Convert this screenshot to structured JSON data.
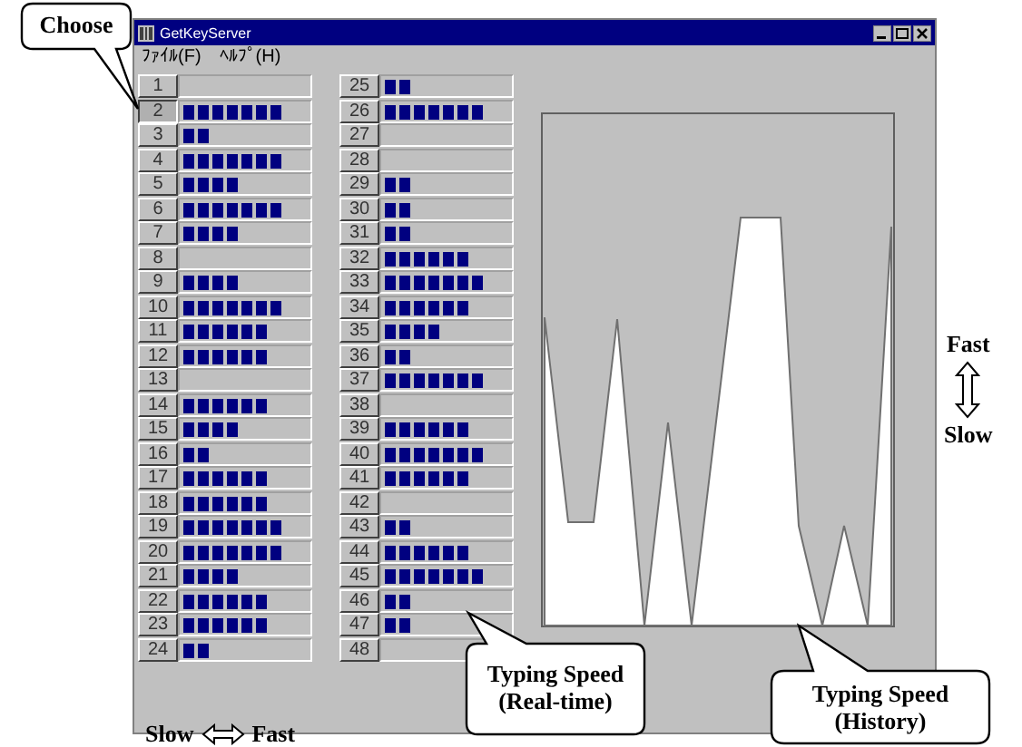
{
  "window": {
    "title": "GetKeyServer"
  },
  "menu": [
    "ﾌｧｲﾙ(F)",
    "ﾍﾙﾌﾟ(H)"
  ],
  "keys": [
    {
      "label": "1",
      "level": 0,
      "selected": false
    },
    {
      "label": "2",
      "level": 0.78,
      "selected": true
    },
    {
      "label": "3",
      "level": 0.22,
      "selected": false
    },
    {
      "label": "4",
      "level": 0.78,
      "selected": false
    },
    {
      "label": "5",
      "level": 0.44,
      "selected": false
    },
    {
      "label": "6",
      "level": 0.78,
      "selected": false
    },
    {
      "label": "7",
      "level": 0.44,
      "selected": false
    },
    {
      "label": "8",
      "level": 0,
      "selected": false
    },
    {
      "label": "9",
      "level": 0.44,
      "selected": false
    },
    {
      "label": "10",
      "level": 0.78,
      "selected": false
    },
    {
      "label": "11",
      "level": 0.67,
      "selected": false
    },
    {
      "label": "12",
      "level": 0.67,
      "selected": false
    },
    {
      "label": "13",
      "level": 0,
      "selected": false
    },
    {
      "label": "14",
      "level": 0.67,
      "selected": false
    },
    {
      "label": "15",
      "level": 0.44,
      "selected": false
    },
    {
      "label": "16",
      "level": 0.22,
      "selected": false
    },
    {
      "label": "17",
      "level": 0.67,
      "selected": false
    },
    {
      "label": "18",
      "level": 0.67,
      "selected": false
    },
    {
      "label": "19",
      "level": 0.78,
      "selected": false
    },
    {
      "label": "20",
      "level": 0.78,
      "selected": false
    },
    {
      "label": "21",
      "level": 0.44,
      "selected": false
    },
    {
      "label": "22",
      "level": 0.67,
      "selected": false
    },
    {
      "label": "23",
      "level": 0.67,
      "selected": false
    },
    {
      "label": "24",
      "level": 0.22,
      "selected": false
    },
    {
      "label": "25",
      "level": 0.22,
      "selected": false
    },
    {
      "label": "26",
      "level": 0.78,
      "selected": false
    },
    {
      "label": "27",
      "level": 0,
      "selected": false
    },
    {
      "label": "28",
      "level": 0,
      "selected": false
    },
    {
      "label": "29",
      "level": 0.22,
      "selected": false
    },
    {
      "label": "30",
      "level": 0.22,
      "selected": false
    },
    {
      "label": "31",
      "level": 0.22,
      "selected": false
    },
    {
      "label": "32",
      "level": 0.67,
      "selected": false
    },
    {
      "label": "33",
      "level": 0.78,
      "selected": false
    },
    {
      "label": "34",
      "level": 0.67,
      "selected": false
    },
    {
      "label": "35",
      "level": 0.44,
      "selected": false
    },
    {
      "label": "36",
      "level": 0.22,
      "selected": false
    },
    {
      "label": "37",
      "level": 0.78,
      "selected": false
    },
    {
      "label": "38",
      "level": 0,
      "selected": false
    },
    {
      "label": "39",
      "level": 0.67,
      "selected": false
    },
    {
      "label": "40",
      "level": 0.78,
      "selected": false
    },
    {
      "label": "41",
      "level": 0.67,
      "selected": false
    },
    {
      "label": "42",
      "level": 0,
      "selected": false
    },
    {
      "label": "43",
      "level": 0.22,
      "selected": false
    },
    {
      "label": "44",
      "level": 0.67,
      "selected": false
    },
    {
      "label": "45",
      "level": 0.78,
      "selected": false
    },
    {
      "label": "46",
      "level": 0.22,
      "selected": false
    },
    {
      "label": "47",
      "level": 0.22,
      "selected": false
    },
    {
      "label": "48",
      "level": 0,
      "selected": false
    }
  ],
  "annotations": {
    "choose": "Choose",
    "realtime": "Typing Speed\n(Real-time)",
    "history": "Typing Speed\n(History)",
    "vertical_scale": {
      "top": "Fast",
      "bottom": "Slow"
    },
    "horizontal_scale": {
      "left": "Slow",
      "right": "Fast"
    }
  }
}
